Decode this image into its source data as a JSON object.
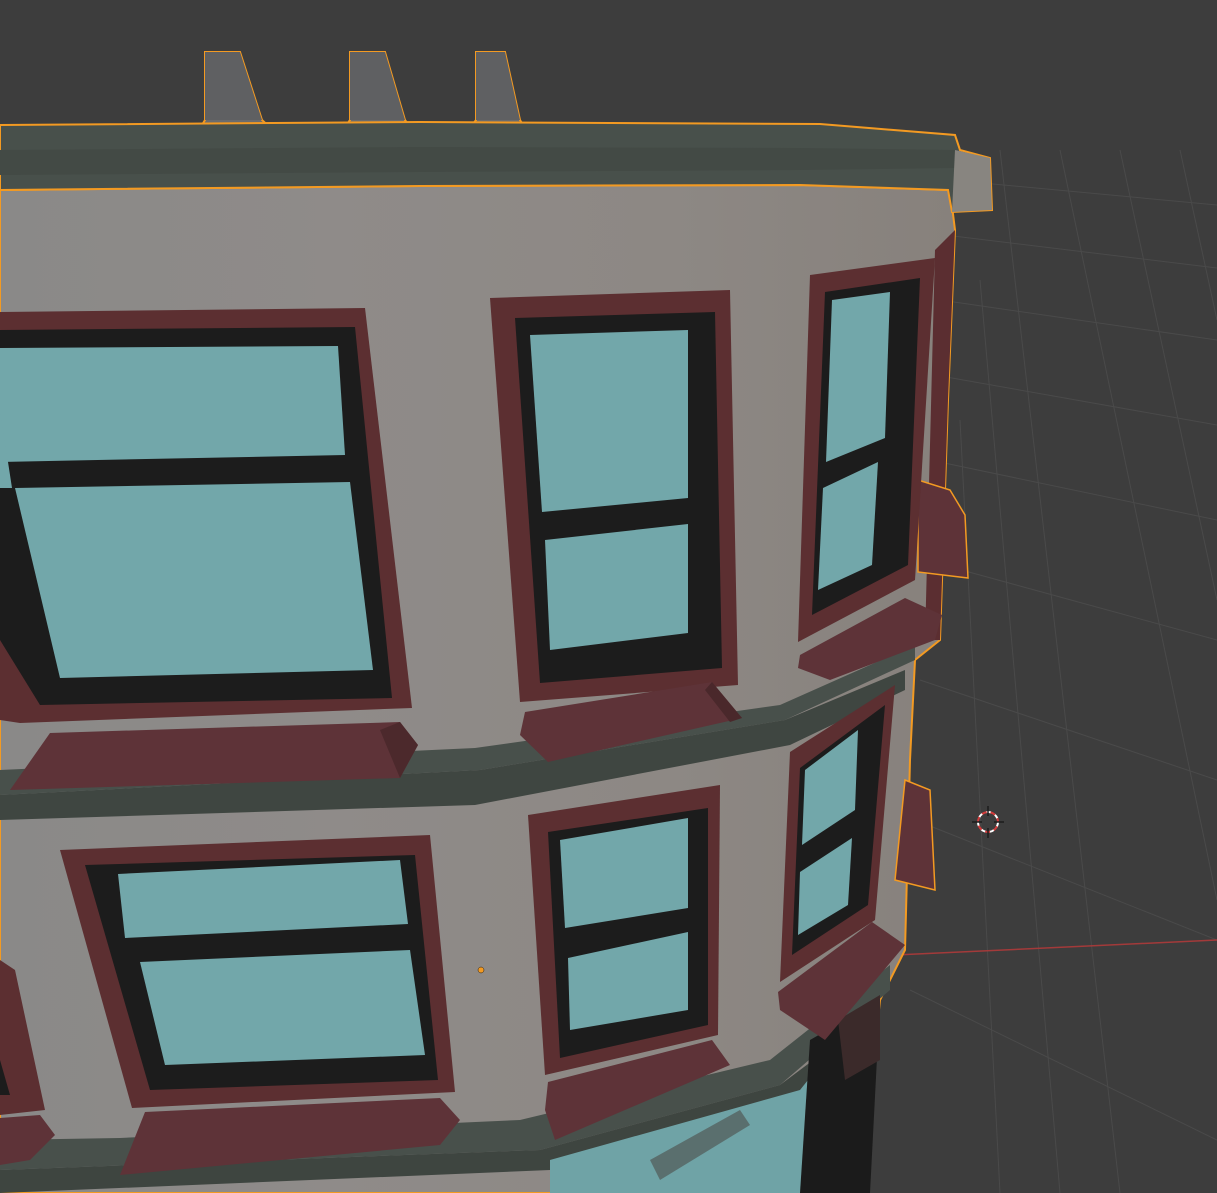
{
  "viewport": {
    "background": "#3d3d3d",
    "grid_color": "#4a4a4a",
    "x_axis_color": "#a33a3a",
    "selection_outline_color": "#f39a22",
    "origin_color": "#f39a22",
    "cursor_icon": "3d-cursor-icon"
  },
  "model": {
    "wall_color": "#8e8b88",
    "cornice_color": "#48504b",
    "frame_color": "#5c2f31",
    "sill_color": "#5e3338",
    "mullion_color": "#1c1c1c",
    "glass_color": "#72a7aa",
    "chimney_color": "#6d6e70",
    "floors": 2,
    "chimneys": 3
  }
}
